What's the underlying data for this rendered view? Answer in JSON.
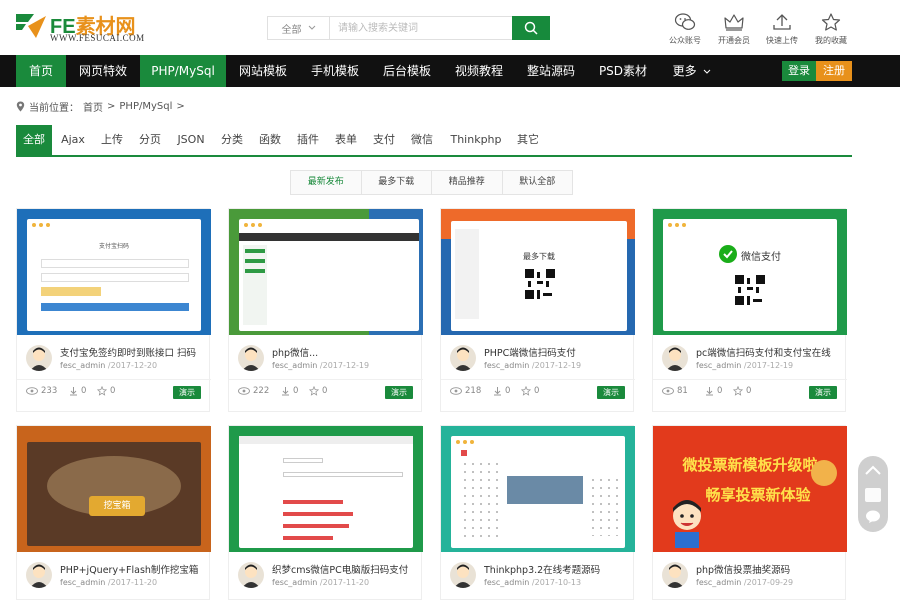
{
  "header": {
    "logo_fe": "FE",
    "logo_cn": "素材网",
    "logo_url": "WWW.FESUCAI.COM",
    "search_category": "全部",
    "search_placeholder": "请输入搜索关键词",
    "quick_links": [
      {
        "label": "公众账号",
        "icon": "wechat-icon"
      },
      {
        "label": "开通会员",
        "icon": "crown-icon"
      },
      {
        "label": "快速上传",
        "icon": "upload-icon"
      },
      {
        "label": "我的收藏",
        "icon": "star-icon"
      }
    ]
  },
  "nav": {
    "items": [
      "首页",
      "网页特效",
      "PHP/MySql",
      "网站模板",
      "手机模板",
      "后台模板",
      "视频教程",
      "整站源码",
      "PSD素材",
      "更多"
    ],
    "active_index": 2,
    "login": "登录",
    "register": "注册"
  },
  "breadcrumb": {
    "prefix": "当前位置：",
    "home": "首页",
    "sep": ">",
    "current": "PHP/MySql",
    "tail": ">"
  },
  "categories": {
    "items": [
      "全部",
      "Ajax",
      "上传",
      "分页",
      "JSON",
      "分类",
      "函数",
      "插件",
      "表单",
      "支付",
      "微信",
      "Thinkphp",
      "其它"
    ],
    "active_index": 0
  },
  "sort_tabs": {
    "items": [
      "最新发布",
      "最多下载",
      "精品推荐",
      "默认全部"
    ],
    "active_index": 0
  },
  "cards": [
    {
      "title": "支付宝免签约即时到账接口 扫码",
      "author": "fesc_admin",
      "date": "/2017-12-20",
      "views": "233",
      "downloads": "0",
      "favs": "0",
      "demo": "演示"
    },
    {
      "title": "php微信...",
      "author": "fesc_admin",
      "date": "/2017-12-19",
      "views": "222",
      "downloads": "0",
      "favs": "0",
      "demo": "演示"
    },
    {
      "title": "PHPC端微信扫码支付",
      "author": "fesc_admin",
      "date": "/2017-12-19",
      "views": "218",
      "downloads": "0",
      "favs": "0",
      "demo": "演示"
    },
    {
      "title": "pc端微信扫码支付和支付宝在线",
      "author": "fesc_admin",
      "date": "/2017-12-19",
      "views": "81",
      "downloads": "0",
      "favs": "0",
      "demo": "演示"
    },
    {
      "title": "PHP+jQuery+Flash制作挖宝箱",
      "author": "fesc_admin",
      "date": "/2017-11-20",
      "views": "",
      "downloads": "",
      "favs": "",
      "demo": ""
    },
    {
      "title": "织梦cms微信PC电脑版扫码支付",
      "author": "fesc_admin",
      "date": "/2017-11-20",
      "views": "",
      "downloads": "",
      "favs": "",
      "demo": ""
    },
    {
      "title": "Thinkphp3.2在线考题源码",
      "author": "fesc_admin",
      "date": "/2017-10-13",
      "views": "",
      "downloads": "",
      "favs": "",
      "demo": ""
    },
    {
      "title": "php微信投票抽奖源码",
      "author": "fesc_admin",
      "date": "/2017-09-29",
      "views": "",
      "downloads": "",
      "favs": "",
      "demo": ""
    }
  ],
  "thumbs": {
    "t1_title": "支付宝扫码",
    "t3_text": "最多下载",
    "t4_text": "微信支付",
    "t5_text": "挖宝箱",
    "t8_line1": "微投票新模板升级啦",
    "t8_line2": "畅享投票新体验"
  },
  "colors": {
    "brand_green": "#1a8a3c",
    "brand_orange": "#e8911b",
    "nav_bg": "#111111"
  }
}
